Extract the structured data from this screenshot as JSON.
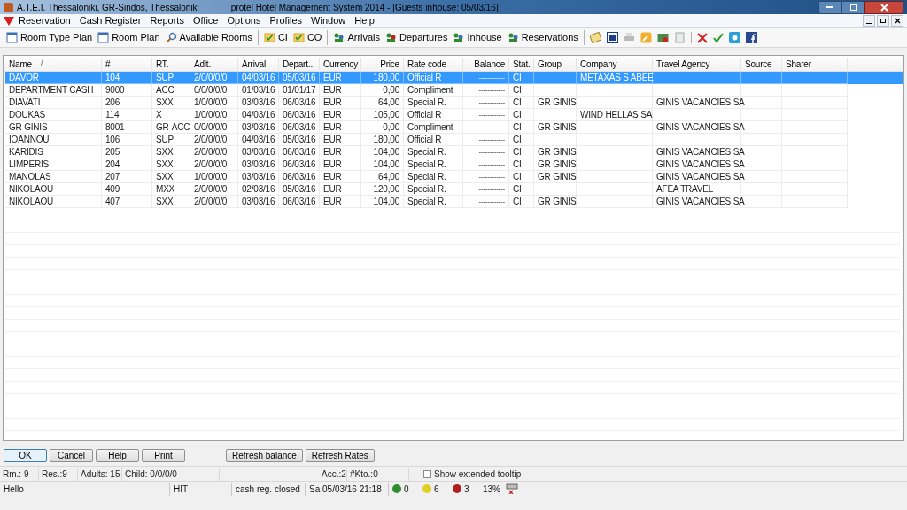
{
  "window": {
    "title_left": "A.T.E.I. Thessaloniki, GR-Sindos, Thessaloniki",
    "title": "protel Hotel Management System 2014 - [Guests inhouse: 05/03/16]"
  },
  "menu": [
    "Reservation",
    "Cash Register",
    "Reports",
    "Office",
    "Options",
    "Profiles",
    "Window",
    "Help"
  ],
  "toolbar": [
    [
      "Room Type Plan",
      "Room Plan",
      "Available Rooms"
    ],
    [
      "CI",
      "CO"
    ],
    [
      "Arrivals",
      "Departures",
      "Inhouse",
      "Reservations"
    ]
  ],
  "table": {
    "columns": [
      "Name",
      "#",
      "RT.",
      "Adlt.",
      "Arrival",
      "Depart...",
      "Currency",
      "Price",
      "Rate code",
      "Balance",
      "Stat.",
      "Group",
      "Company",
      "Travel Agency",
      "Source",
      "Sharer"
    ],
    "sort_mark": "/",
    "rows": [
      {
        "selected": true,
        "cells": [
          "DAVOR",
          "104",
          "SUP",
          "2/0/0/0/0",
          "04/03/16",
          "05/03/16",
          "EUR",
          "180,00",
          "Official R",
          "------------",
          "CI",
          "",
          "METAXAS S ABEE",
          "",
          "",
          ""
        ]
      },
      {
        "selected": false,
        "cells": [
          "DEPARTMENT CASH",
          "9000",
          "ACC",
          "0/0/0/0/0",
          "01/03/16",
          "01/01/17",
          "EUR",
          "0,00",
          "Compliment",
          "------------",
          "CI",
          "",
          "",
          "",
          "",
          ""
        ]
      },
      {
        "selected": false,
        "cells": [
          "DIAVATI",
          "206",
          "SXX",
          "1/0/0/0/0",
          "03/03/16",
          "06/03/16",
          "EUR",
          "64,00",
          "Special R.",
          "------------",
          "CI",
          "GR GINIS",
          "",
          "GINIS VACANCIES SA",
          "",
          ""
        ]
      },
      {
        "selected": false,
        "cells": [
          "DOUKAS",
          "114",
          "X",
          "1/0/0/0/0",
          "04/03/16",
          "06/03/16",
          "EUR",
          "105,00",
          "Official R",
          "------------",
          "CI",
          "",
          "WIND HELLAS SA",
          "",
          "",
          ""
        ]
      },
      {
        "selected": false,
        "cells": [
          "GR GINIS",
          "8001",
          "GR-ACC",
          "0/0/0/0/0",
          "03/03/16",
          "06/03/16",
          "EUR",
          "0,00",
          "Compliment",
          "------------",
          "CI",
          "GR GINIS",
          "",
          "GINIS VACANCIES SA",
          "",
          ""
        ]
      },
      {
        "selected": false,
        "cells": [
          "IOANNOU",
          "106",
          "SUP",
          "2/0/0/0/0",
          "04/03/16",
          "05/03/16",
          "EUR",
          "180,00",
          "Official R",
          "------------",
          "CI",
          "",
          "",
          "",
          "",
          ""
        ]
      },
      {
        "selected": false,
        "cells": [
          "KARIDIS",
          "205",
          "SXX",
          "2/0/0/0/0",
          "03/03/16",
          "06/03/16",
          "EUR",
          "104,00",
          "Special R.",
          "------------",
          "CI",
          "GR GINIS",
          "",
          "GINIS VACANCIES SA",
          "",
          ""
        ]
      },
      {
        "selected": false,
        "cells": [
          "LIMPERIS",
          "204",
          "SXX",
          "2/0/0/0/0",
          "03/03/16",
          "06/03/16",
          "EUR",
          "104,00",
          "Special R.",
          "------------",
          "CI",
          "GR GINIS",
          "",
          "GINIS VACANCIES SA",
          "",
          ""
        ]
      },
      {
        "selected": false,
        "cells": [
          "MANOLAS",
          "207",
          "SXX",
          "1/0/0/0/0",
          "03/03/16",
          "06/03/16",
          "EUR",
          "64,00",
          "Special R.",
          "------------",
          "CI",
          "GR GINIS",
          "",
          "GINIS VACANCIES SA",
          "",
          ""
        ]
      },
      {
        "selected": false,
        "cells": [
          "NIKOLAOU",
          "409",
          "MXX",
          "2/0/0/0/0",
          "02/03/16",
          "05/03/16",
          "EUR",
          "120,00",
          "Special R.",
          "------------",
          "CI",
          "",
          "",
          "AFEA TRAVEL",
          "",
          ""
        ]
      },
      {
        "selected": false,
        "cells": [
          "NIKOLAOU",
          "407",
          "SXX",
          "2/0/0/0/0",
          "03/03/16",
          "06/03/16",
          "EUR",
          "104,00",
          "Special R.",
          "------------",
          "CI",
          "GR GINIS",
          "",
          "GINIS VACANCIES SA",
          "",
          ""
        ]
      }
    ]
  },
  "buttons": [
    [
      {
        "label": "OK",
        "default": true
      },
      {
        "label": "Cancel",
        "default": false
      },
      {
        "label": "Help",
        "default": false
      },
      {
        "label": "Print",
        "default": false
      }
    ],
    [
      {
        "label": "Refresh balance",
        "default": false
      },
      {
        "label": "Refresh Rates",
        "default": false
      }
    ]
  ],
  "info": [
    "Rm.: 9",
    "Res.:9",
    "Adults: 15",
    "Child: 0/0/0/0",
    "Acc.:2",
    "#Kto.:0"
  ],
  "extended_tooltip": {
    "label": "Show extended tooltip",
    "checked": false
  },
  "status_bar": {
    "texts": [
      "Hello",
      "HIT",
      "cash reg. closed",
      "Sa 05/03/16 21:18"
    ],
    "counters": [
      {
        "value": "0",
        "color": "#2e8b2e"
      },
      {
        "value": "6",
        "color": "#e0d020"
      },
      {
        "value": "3",
        "color": "#b02020"
      }
    ],
    "percent": "13%"
  }
}
